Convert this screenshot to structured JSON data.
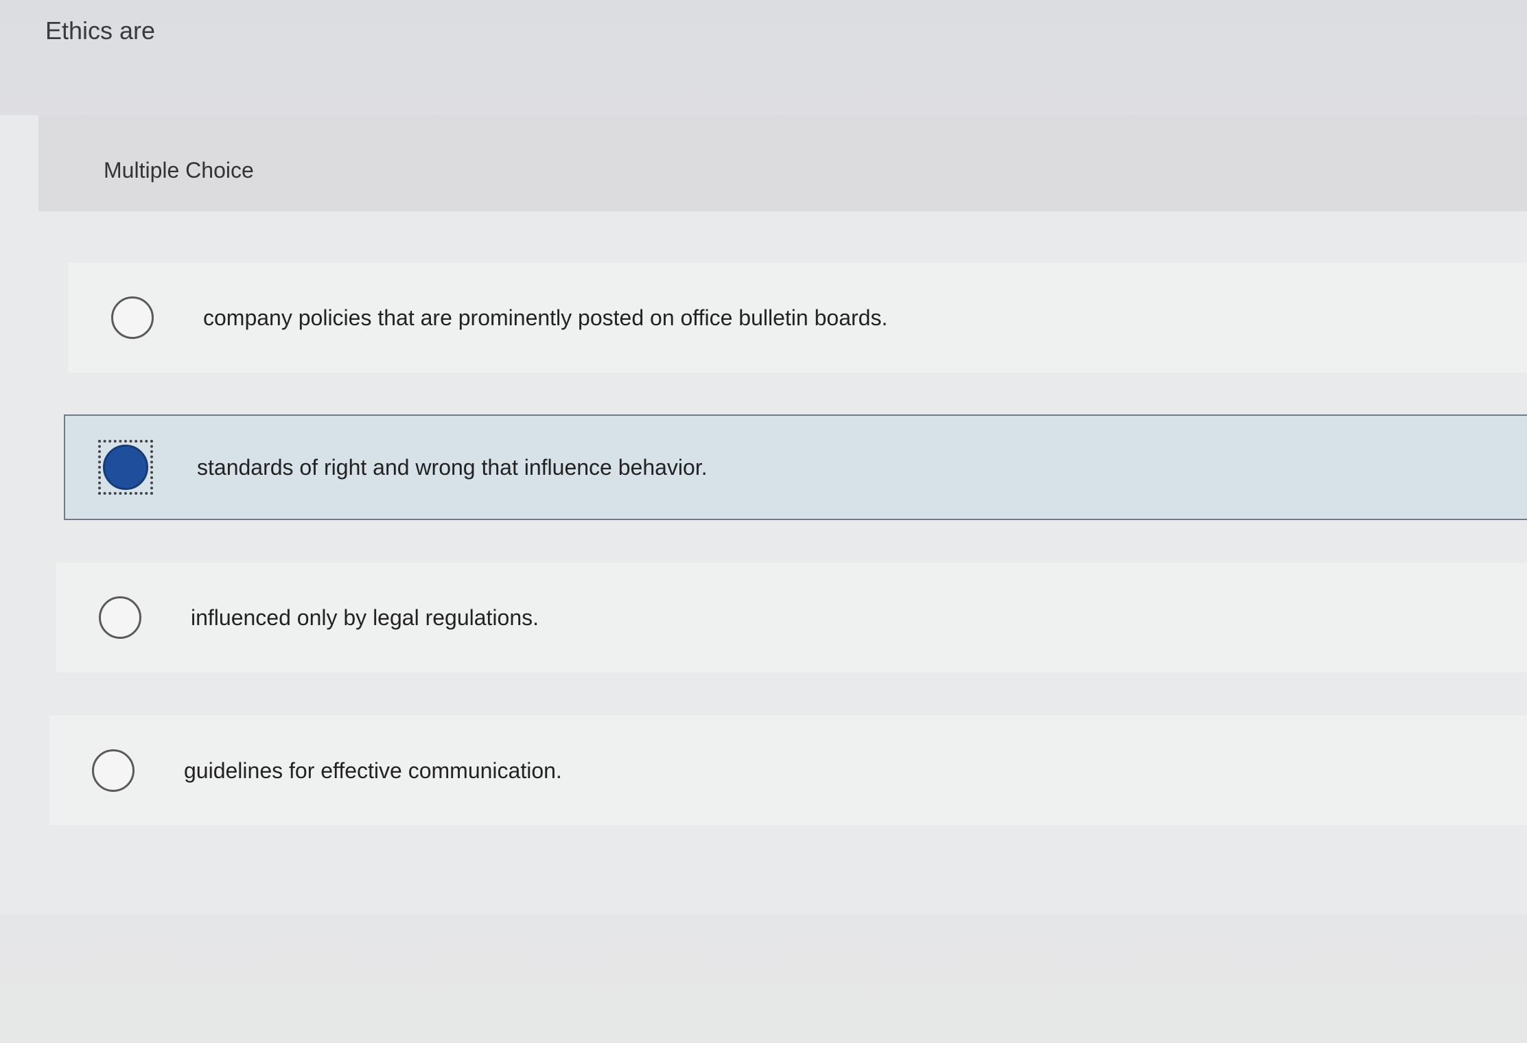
{
  "question": {
    "text": "Ethics are"
  },
  "panel": {
    "title": "Multiple Choice"
  },
  "options": [
    {
      "label": "company policies that are prominently posted on office bulletin boards.",
      "selected": false
    },
    {
      "label": "standards of right and wrong that influence behavior.",
      "selected": true
    },
    {
      "label": "influenced only by legal regulations.",
      "selected": false
    },
    {
      "label": "guidelines for effective communication.",
      "selected": false
    }
  ],
  "colors": {
    "selected_fill": "#1f4f9c",
    "selected_row": "#d6e1e8"
  }
}
